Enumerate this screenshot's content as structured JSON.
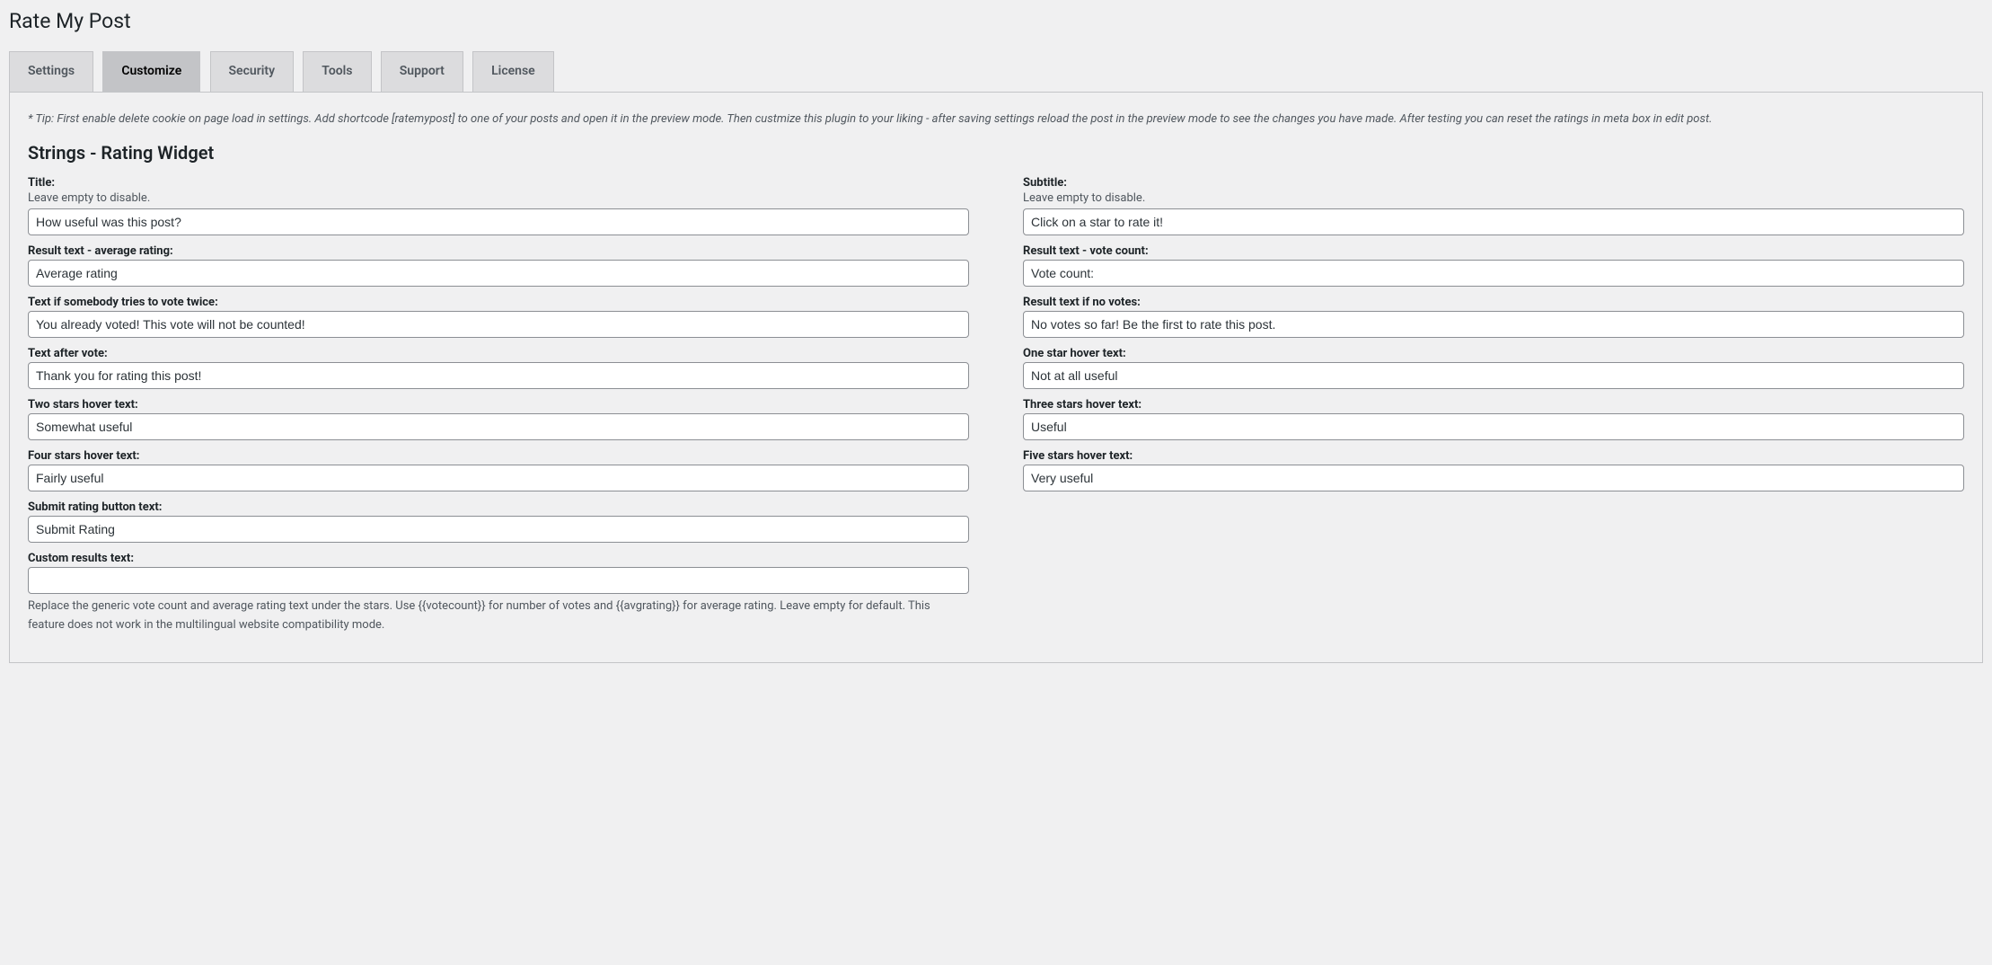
{
  "page_title": "Rate My Post",
  "tabs": [
    {
      "label": "Settings",
      "active": false
    },
    {
      "label": "Customize",
      "active": true
    },
    {
      "label": "Security",
      "active": false
    },
    {
      "label": "Tools",
      "active": false
    },
    {
      "label": "Support",
      "active": false
    },
    {
      "label": "License",
      "active": false
    }
  ],
  "tip": "* Tip: First enable delete cookie on page load in settings. Add shortcode [ratemypost] to one of your posts and open it in the preview mode. Then custmize this plugin to your liking - after saving settings reload the post in the preview mode to see the changes you have made. After testing you can reset the ratings in meta box in edit post.",
  "section_title": "Strings - Rating Widget",
  "left": {
    "title": {
      "label": "Title:",
      "hint": "Leave empty to disable.",
      "value": "How useful was this post?"
    },
    "result_avg": {
      "label": "Result text - average rating:",
      "value": "Average rating"
    },
    "vote_twice": {
      "label": "Text if somebody tries to vote twice:",
      "value": "You already voted! This vote will not be counted!"
    },
    "after_vote": {
      "label": "Text after vote:",
      "value": "Thank you for rating this post!"
    },
    "two_stars": {
      "label": "Two stars hover text:",
      "value": "Somewhat useful"
    },
    "four_stars": {
      "label": "Four stars hover text:",
      "value": "Fairly useful"
    },
    "submit_btn": {
      "label": "Submit rating button text:",
      "value": "Submit Rating"
    },
    "custom_results": {
      "label": "Custom results text:",
      "value": "",
      "hint_after": "Replace the generic vote count and average rating text under the stars. Use {{votecount}} for number of votes and {{avgrating}} for average rating. Leave empty for default. This feature does not work in the multilingual website compatibility mode."
    }
  },
  "right": {
    "subtitle": {
      "label": "Subtitle:",
      "hint": "Leave empty to disable.",
      "value": "Click on a star to rate it!"
    },
    "result_count": {
      "label": "Result text - vote count:",
      "value": "Vote count:"
    },
    "no_votes": {
      "label": "Result text if no votes:",
      "value": "No votes so far! Be the first to rate this post."
    },
    "one_star": {
      "label": "One star hover text:",
      "value": "Not at all useful"
    },
    "three_stars": {
      "label": "Three stars hover text:",
      "value": "Useful"
    },
    "five_stars": {
      "label": "Five stars hover text:",
      "value": "Very useful"
    }
  }
}
